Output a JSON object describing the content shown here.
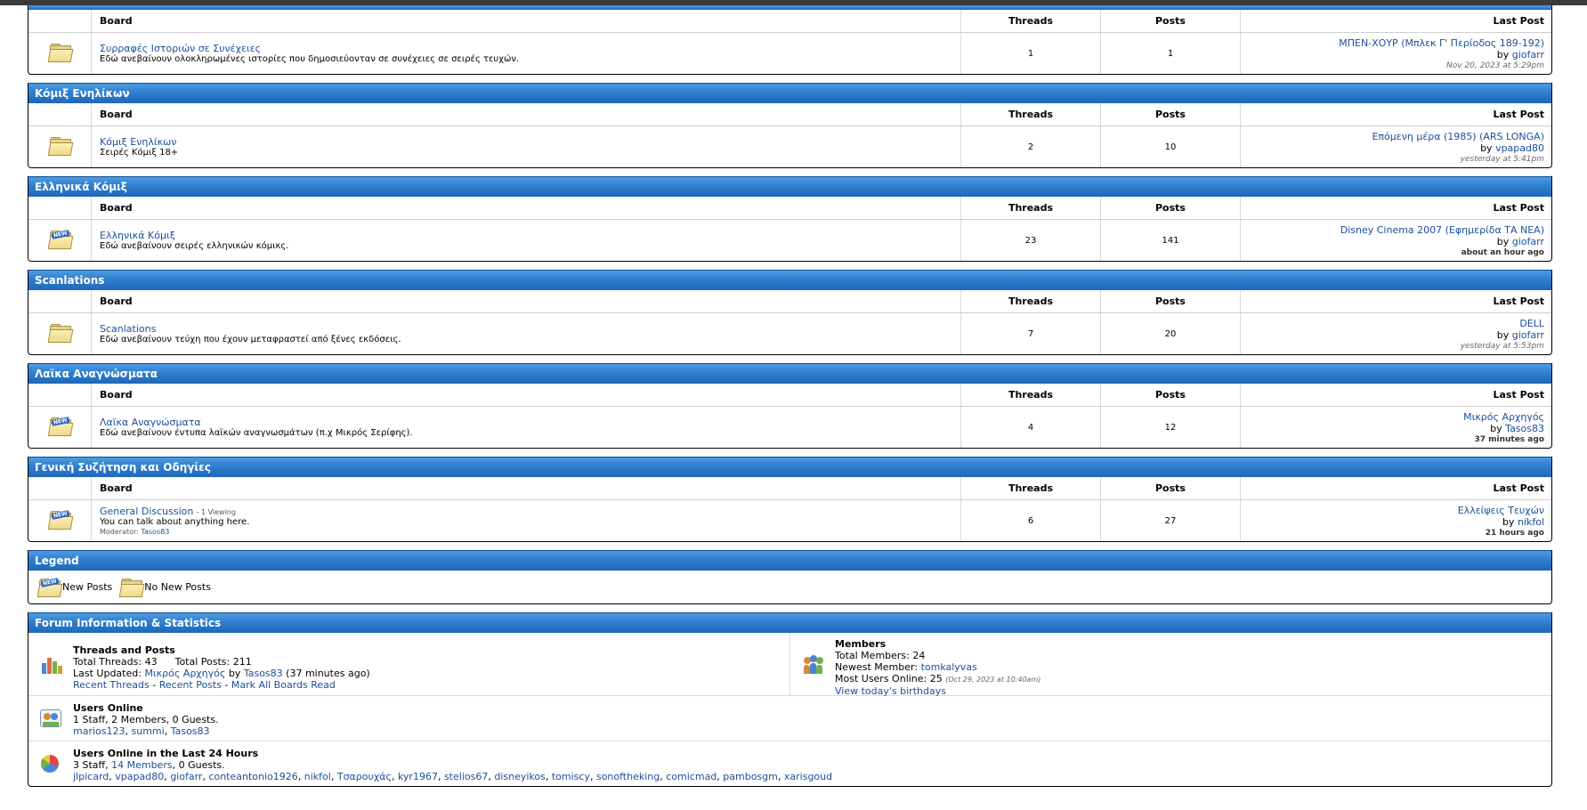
{
  "headers": {
    "board": "Board",
    "threads": "Threads",
    "posts": "Posts",
    "last_post": "Last Post"
  },
  "categories": [
    {
      "title": "",
      "board": {
        "name": "Συρραφές Ιστοριών σε Συνέχειες",
        "desc": "Εδώ ανεβαίνουν ολοκληρωμένες ιστορίες που δημοσιεύονταν σε συνέχειες σε σειρές τευχών.",
        "threads": "1",
        "posts": "1",
        "last_title": "ΜΠΕΝ-ΧΟΥΡ (Μπλεκ Γ' Περίοδος 189-192)",
        "by": "by",
        "last_user": "giofarr",
        "last_time": "Nov 20, 2023 at 5:29pm",
        "is_new": false
      }
    },
    {
      "title": "Κόμιξ Ενηλίκων",
      "board": {
        "name": "Κόμιξ Ενηλίκων",
        "desc": "Σειρές Κόμιξ 18+",
        "threads": "2",
        "posts": "10",
        "last_title": "Επόμενη μέρα (1985) (ARS LONGA)",
        "by": "by",
        "last_user": "vpapad80",
        "last_time": "yesterday at 5:41pm",
        "is_new": false
      }
    },
    {
      "title": "Ελληνικά Κόμιξ",
      "board": {
        "name": "Ελληνικά Κόμιξ",
        "desc": "Εδώ ανεβαίνουν σειρές ελληνικών κόμικς.",
        "threads": "23",
        "posts": "141",
        "last_title": "Disney Cinema 2007 (Εφημερίδα ΤΑ ΝΕΑ)",
        "by": "by",
        "last_user": "giofarr",
        "last_time": "about an hour ago",
        "is_new": true
      }
    },
    {
      "title": "Scanlations",
      "board": {
        "name": "Scanlations",
        "desc": "Εδώ ανεβαίνουν τεύχη που έχουν μεταφραστεί από ξένες εκδόσεις.",
        "threads": "7",
        "posts": "20",
        "last_title": "DELL",
        "by": "by",
        "last_user": "giofarr",
        "last_time": "yesterday at 5:53pm",
        "is_new": false
      }
    },
    {
      "title": "Λαϊκα Αναγνώσματα",
      "board": {
        "name": "Λαϊκα Αναγνώσματα",
        "desc": "Εδώ ανεβαίνουν έντυπα λαϊκών αναγνωσμάτων (π.χ Μικρός Σερίφης).",
        "threads": "4",
        "posts": "12",
        "last_title": "Μικρός Αρχηγός",
        "by": "by",
        "last_user": "Tasos83",
        "last_time": "37 minutes ago",
        "is_new": true
      }
    },
    {
      "title": "Γενική Συζήτηση και Οδηγίες",
      "board": {
        "name": "General Discussion",
        "viewing": "- 1 Viewing",
        "desc": "You can talk about anything here.",
        "moderator_label": "Moderator:",
        "moderator": "Tasos83",
        "threads": "6",
        "posts": "27",
        "last_title": "Ελλείψεις Τευχών",
        "by": "by",
        "last_user": "nikfol",
        "last_time": "21 hours ago",
        "is_new": true
      }
    }
  ],
  "legend": {
    "title": "Legend",
    "new_posts": "New Posts",
    "no_new_posts": "No New Posts"
  },
  "stats": {
    "title": "Forum Information & Statistics",
    "threads_posts": {
      "heading": "Threads and Posts",
      "total_threads": "Total Threads: 43",
      "total_posts": "Total Posts: 211",
      "last_updated_label": "Last Updated:",
      "last_updated_thread": "Μικρός Αρχηγός",
      "by": "by",
      "last_updated_user": "Tasos83",
      "last_updated_time": "(37 minutes ago)",
      "recent_threads": "Recent Threads",
      "recent_posts": "Recent Posts",
      "mark_all": "Mark All Boards Read"
    },
    "members": {
      "heading": "Members",
      "total": "Total Members: 24",
      "newest_label": "Newest Member:",
      "newest": "tomkalyvas",
      "most_online": "Most Users Online: 25",
      "most_online_time": "(Oct 29, 2023 at 10:40am)",
      "birthdays": "View today's birthdays"
    },
    "online": {
      "heading": "Users Online",
      "summary": "1 Staff, 2 Members, 0 Guests.",
      "users": [
        "marios123",
        "summi",
        "Tasos83"
      ]
    },
    "online24": {
      "heading": "Users Online in the Last 24 Hours",
      "summary_staff": "3 Staff,",
      "summary_members": "14 Members",
      "summary_guests": ", 0 Guests.",
      "users": [
        "jlpicard",
        "vpapad80",
        "giofarr",
        "conteantonio1926",
        "nikfol",
        "Τσαρουχάς",
        "kyr1967",
        "stelios67",
        "disneyikos",
        "tomiscy",
        "sonoftheking",
        "comicmad",
        "pambosgm",
        "xarisgoud"
      ]
    }
  }
}
